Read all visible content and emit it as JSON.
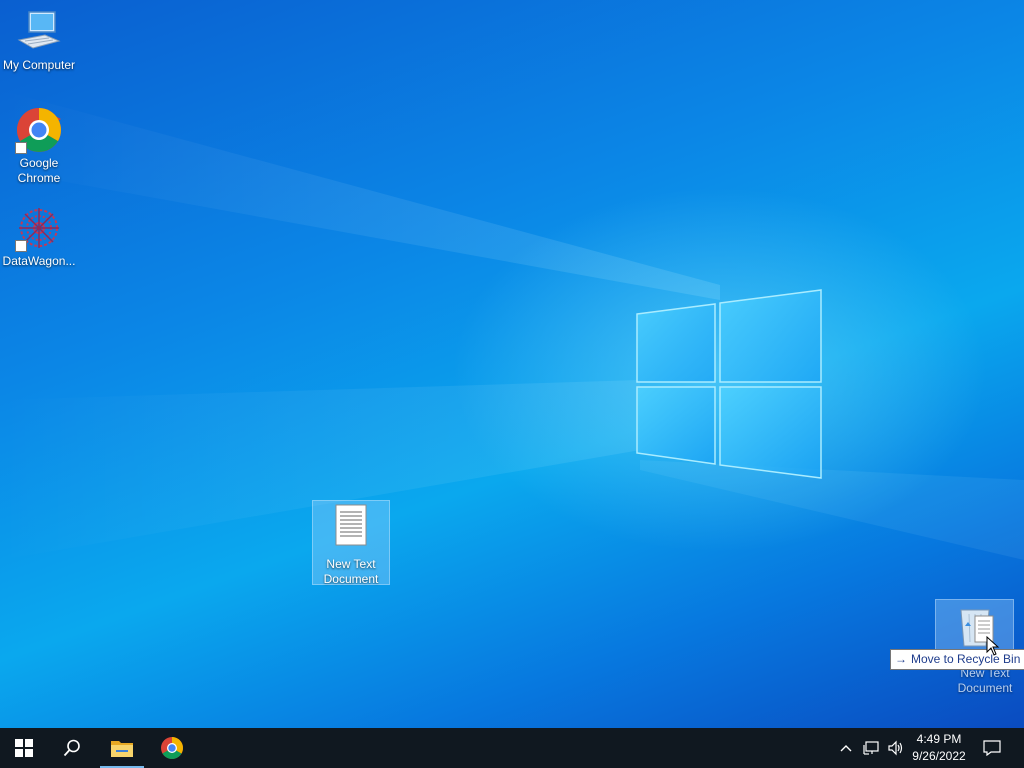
{
  "desktop": {
    "icons": [
      {
        "label": "My Computer"
      },
      {
        "label": "Google Chrome"
      },
      {
        "label": "DataWagon..."
      },
      {
        "label": "New Text Document"
      },
      {
        "label": "New Text Document"
      }
    ],
    "tooltip": "Move to Recycle Bin"
  },
  "taskbar": {
    "clock": {
      "time": "4:49 PM",
      "date": "9/26/2022"
    }
  },
  "colors": {
    "taskbar": "#101820",
    "accent": "#76b9ed",
    "selection": "#aad7ff"
  }
}
